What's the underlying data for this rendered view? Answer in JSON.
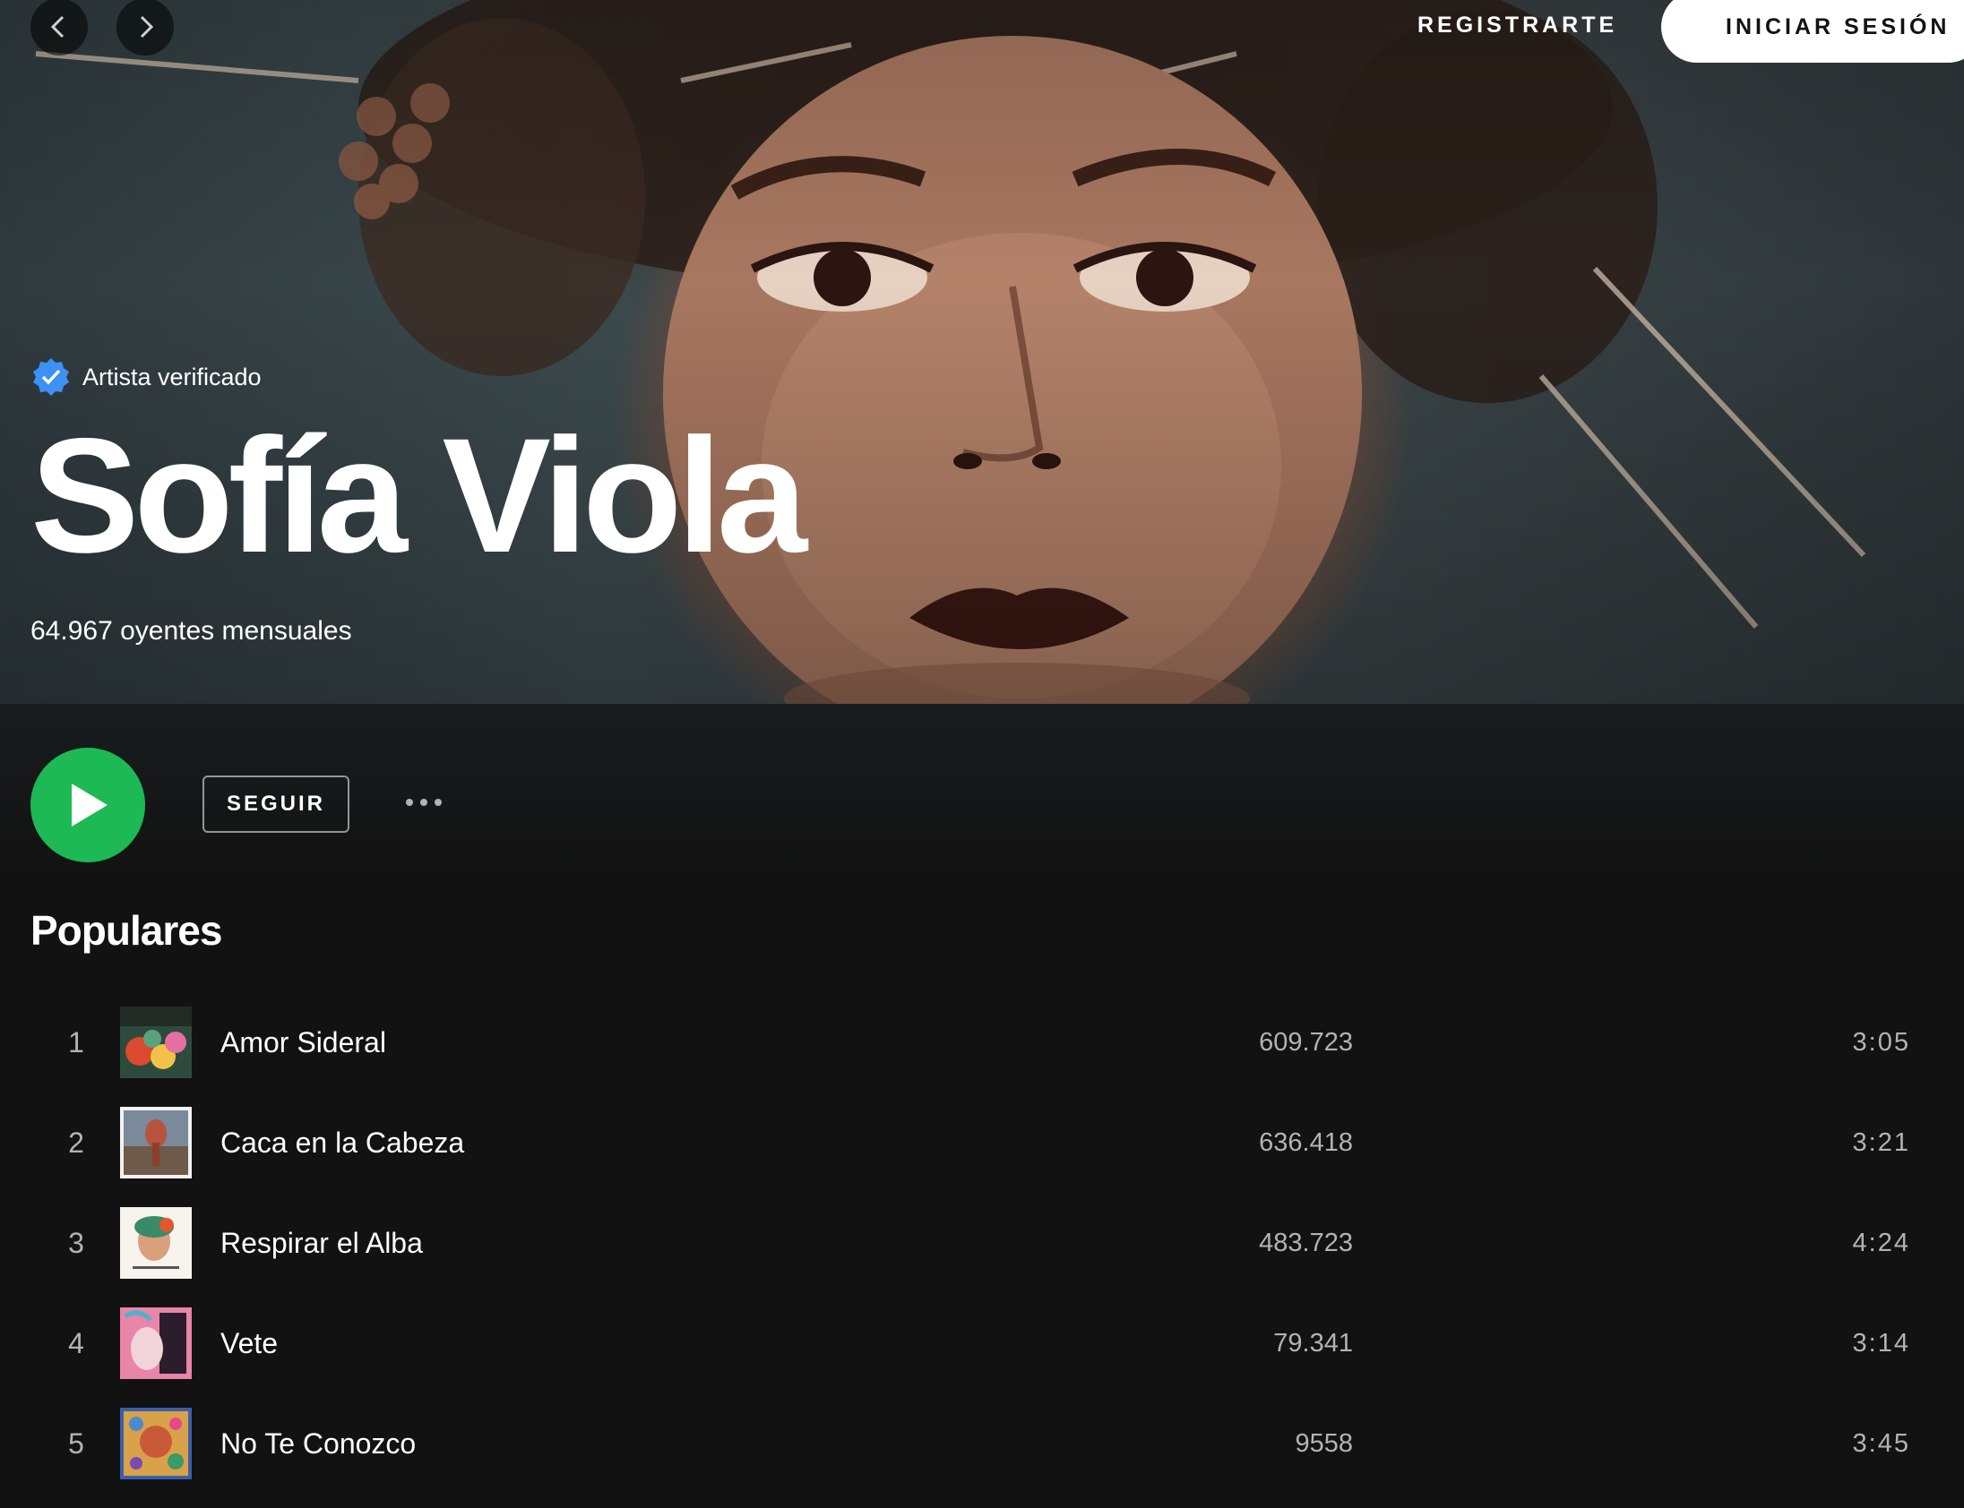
{
  "header": {
    "signup_label": "REGISTRARTE",
    "login_label": "INICIAR SESIÓN",
    "prev_icon": "chevron-left-icon",
    "next_icon": "chevron-right-icon"
  },
  "artist": {
    "verified_label": "Artista verificado",
    "name": "Sofía Viola",
    "monthly_listeners": "64.967 oyentes mensuales"
  },
  "actions": {
    "follow_label": "SEGUIR",
    "play_icon": "play-icon",
    "more_icon": "more-icon"
  },
  "popular": {
    "title": "Populares",
    "tracks": [
      {
        "number": "1",
        "title": "Amor Sideral",
        "plays": "609.723",
        "duration": "3:05"
      },
      {
        "number": "2",
        "title": "Caca en la Cabeza",
        "plays": "636.418",
        "duration": "3:21"
      },
      {
        "number": "3",
        "title": "Respirar el Alba",
        "plays": "483.723",
        "duration": "4:24"
      },
      {
        "number": "4",
        "title": "Vete",
        "plays": "79.341",
        "duration": "3:14"
      },
      {
        "number": "5",
        "title": "No Te Conozco",
        "plays": "9558",
        "duration": "3:45"
      }
    ]
  },
  "colors": {
    "accent": "#1db954",
    "background": "#121212",
    "verified_badge": "#3d91f4"
  }
}
